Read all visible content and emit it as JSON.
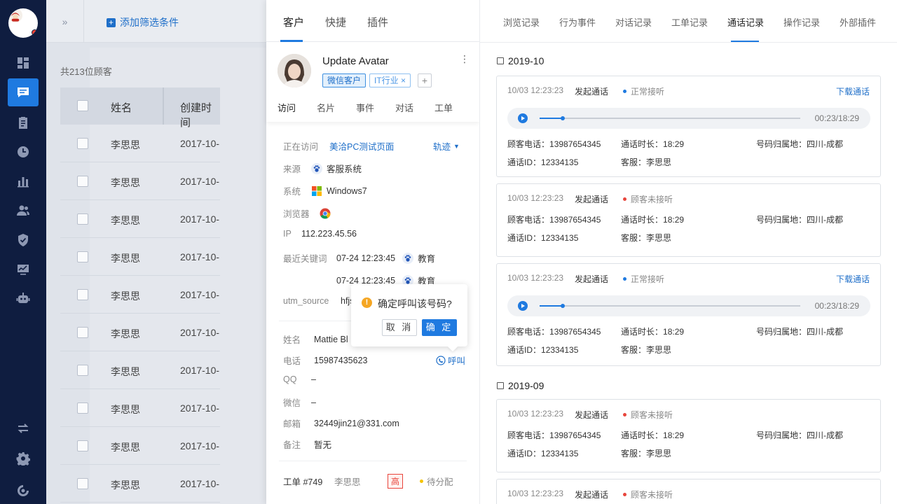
{
  "nav": {
    "items": [
      {
        "name": "dashboard-icon",
        "active": false
      },
      {
        "name": "chat-icon",
        "active": true
      },
      {
        "name": "clipboard-icon",
        "active": false
      },
      {
        "name": "clock-icon",
        "active": false
      },
      {
        "name": "bar-chart-icon",
        "active": false
      },
      {
        "name": "users-icon",
        "active": false
      },
      {
        "name": "shield-icon",
        "active": false
      },
      {
        "name": "monitor-icon",
        "active": false
      },
      {
        "name": "robot-icon",
        "active": false
      }
    ],
    "bottom": [
      "transfer-icon",
      "gear-icon",
      "headset-icon"
    ]
  },
  "list": {
    "add_filter": "添加筛选条件",
    "total": "共213位顾客",
    "col_name": "姓名",
    "col_created": "创建时间",
    "rows": [
      {
        "name": "李思思",
        "created": "2017-10-"
      },
      {
        "name": "李思思",
        "created": "2017-10-"
      },
      {
        "name": "李思思",
        "created": "2017-10-"
      },
      {
        "name": "李思思",
        "created": "2017-10-"
      },
      {
        "name": "李思思",
        "created": "2017-10-"
      },
      {
        "name": "李思思",
        "created": "2017-10-"
      },
      {
        "name": "李思思",
        "created": "2017-10-"
      },
      {
        "name": "李思思",
        "created": "2017-10-"
      },
      {
        "name": "李思思",
        "created": "2017-10-"
      },
      {
        "name": "李思思",
        "created": "2017-10-"
      }
    ]
  },
  "detail": {
    "tabs": [
      "客户",
      "快捷",
      "插件"
    ],
    "profile": {
      "name": "Update Avatar",
      "tag_wechat": "微信客户",
      "tag_it": "IT行业",
      "tag_it_close": "×",
      "tag_add": "+",
      "more": "⋮"
    },
    "subtabs": [
      "访问",
      "名片",
      "事件",
      "对话",
      "工单"
    ],
    "visiting_label": "正在访问",
    "visiting_value": "美洽PC测试页面",
    "track_label": "轨迹",
    "source_label": "来源",
    "source_value": "客服系统",
    "system_label": "系统",
    "system_value": "Windows7",
    "browser_label": "浏览器",
    "ip_label": "IP",
    "ip_value": "112.223.45.56",
    "keyword_label": "最近关键词",
    "keywords": [
      {
        "time": "07-24 12:23:45",
        "word": "教育"
      },
      {
        "time": "07-24 12:23:45",
        "word": "教育"
      }
    ],
    "utm_label": "utm_source",
    "utm_value": "hfjs",
    "name_label": "姓名",
    "name_value": "Mattie Bl",
    "phone_label": "电话",
    "phone_value": "15987435623",
    "call_label": "呼叫",
    "qq_label": "QQ",
    "qq_value": "–",
    "wechat_label": "微信",
    "wechat_value": "–",
    "email_label": "邮箱",
    "email_value": "32449jin21@331.com",
    "remark_label": "备注",
    "remark_value": "暂无",
    "ticket_label": "工单 #749",
    "ticket_agent": "李思思",
    "ticket_priority": "高",
    "ticket_status": "待分配"
  },
  "popconfirm": {
    "text": "确定呼叫该号码?",
    "cancel": "取 消",
    "ok": "确 定"
  },
  "right": {
    "tabs": [
      "浏览记录",
      "行为事件",
      "对话记录",
      "工单记录",
      "通话记录",
      "操作记录",
      "外部插件"
    ],
    "active_tab": "通话记录",
    "months": [
      "2019-10",
      "2019-09"
    ],
    "calls": [
      {
        "time": "10/03  12:23:23",
        "action": "发起通话",
        "status": "正常接听",
        "status_color": "#1f7ae0",
        "download": "下载通话",
        "has_player": true,
        "progress": 0.09,
        "player_time": "00:23/18:29",
        "phone_label": "顾客电话：",
        "phone": "13987654345",
        "duration_label": "通话时长：",
        "duration": "18:29",
        "region_label": "号码归属地：",
        "region": "四川-成都",
        "id_label": "通话ID：",
        "id": "12334135",
        "agent_label": "客服：",
        "agent": "李思思"
      },
      {
        "time": "10/03  12:23:23",
        "action": "发起通话",
        "status": "顾客未接听",
        "status_color": "#e8453c",
        "download": "",
        "has_player": false,
        "phone_label": "顾客电话：",
        "phone": "13987654345",
        "duration_label": "通话时长：",
        "duration": "18:29",
        "region_label": "号码归属地：",
        "region": "四川-成都",
        "id_label": "通话ID：",
        "id": "12334135",
        "agent_label": "客服：",
        "agent": "李思思"
      },
      {
        "time": "10/03  12:23:23",
        "action": "发起通话",
        "status": "正常接听",
        "status_color": "#1f7ae0",
        "download": "下载通话",
        "has_player": true,
        "progress": 0.09,
        "player_time": "00:23/18:29",
        "phone_label": "顾客电话：",
        "phone": "13987654345",
        "duration_label": "通话时长：",
        "duration": "18:29",
        "region_label": "号码归属地：",
        "region": "四川-成都",
        "id_label": "通话ID：",
        "id": "12334135",
        "agent_label": "客服：",
        "agent": "李思思"
      },
      {
        "time": "10/03  12:23:23",
        "action": "发起通话",
        "status": "顾客未接听",
        "status_color": "#e8453c",
        "download": "",
        "has_player": false,
        "phone_label": "顾客电话：",
        "phone": "13987654345",
        "duration_label": "通话时长：",
        "duration": "18:29",
        "region_label": "号码归属地：",
        "region": "四川-成都",
        "id_label": "通话ID：",
        "id": "12334135",
        "agent_label": "客服：",
        "agent": "李思思"
      },
      {
        "time": "10/03  12:23:23",
        "action": "发起通话",
        "status": "顾客未接听",
        "status_color": "#e8453c",
        "download": "",
        "has_player": false,
        "phone_label": "",
        "phone": "",
        "duration_label": "",
        "duration": "",
        "region_label": "",
        "region": "",
        "id_label": "",
        "id": "",
        "agent_label": "",
        "agent": ""
      }
    ]
  }
}
